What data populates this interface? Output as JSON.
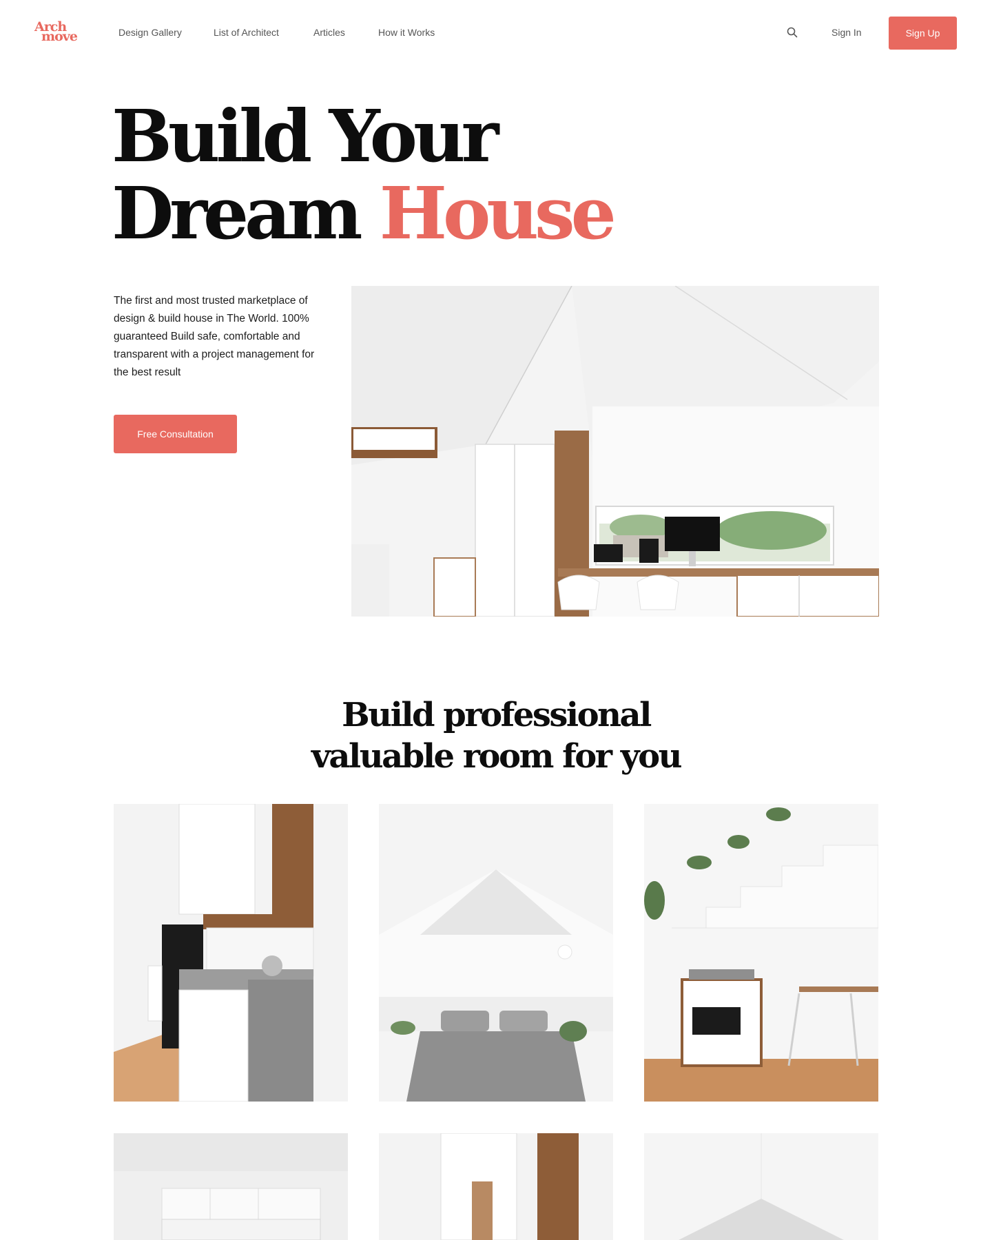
{
  "brand": {
    "logo_line1": "Arch",
    "logo_line2": "move",
    "accent_color": "#e8695f"
  },
  "nav": {
    "links": [
      "Design Gallery",
      "List of Architect",
      "Articles",
      "How it Works"
    ],
    "search_icon": "search-icon",
    "sign_in": "Sign In",
    "sign_up": "Sign Up"
  },
  "hero": {
    "title_line1": "Build Your",
    "title_line2_part1": "Dream",
    "title_line2_accent": "House",
    "description": "The first and most trusted marketplace of design & build house in The World. 100% guaranteed Build safe, comfortable and transparent with a project management for the best result",
    "cta": "Free Consultation"
  },
  "section": {
    "title_line1": "Build professional",
    "title_line2": "valuable room for you"
  },
  "gallery": [
    {
      "name": "kitchen-photo"
    },
    {
      "name": "bedroom-photo"
    },
    {
      "name": "study-corner-photo"
    },
    {
      "name": "white-cabinets-photo"
    },
    {
      "name": "kitchen-shelves-photo"
    },
    {
      "name": "gable-wall-photo"
    }
  ]
}
